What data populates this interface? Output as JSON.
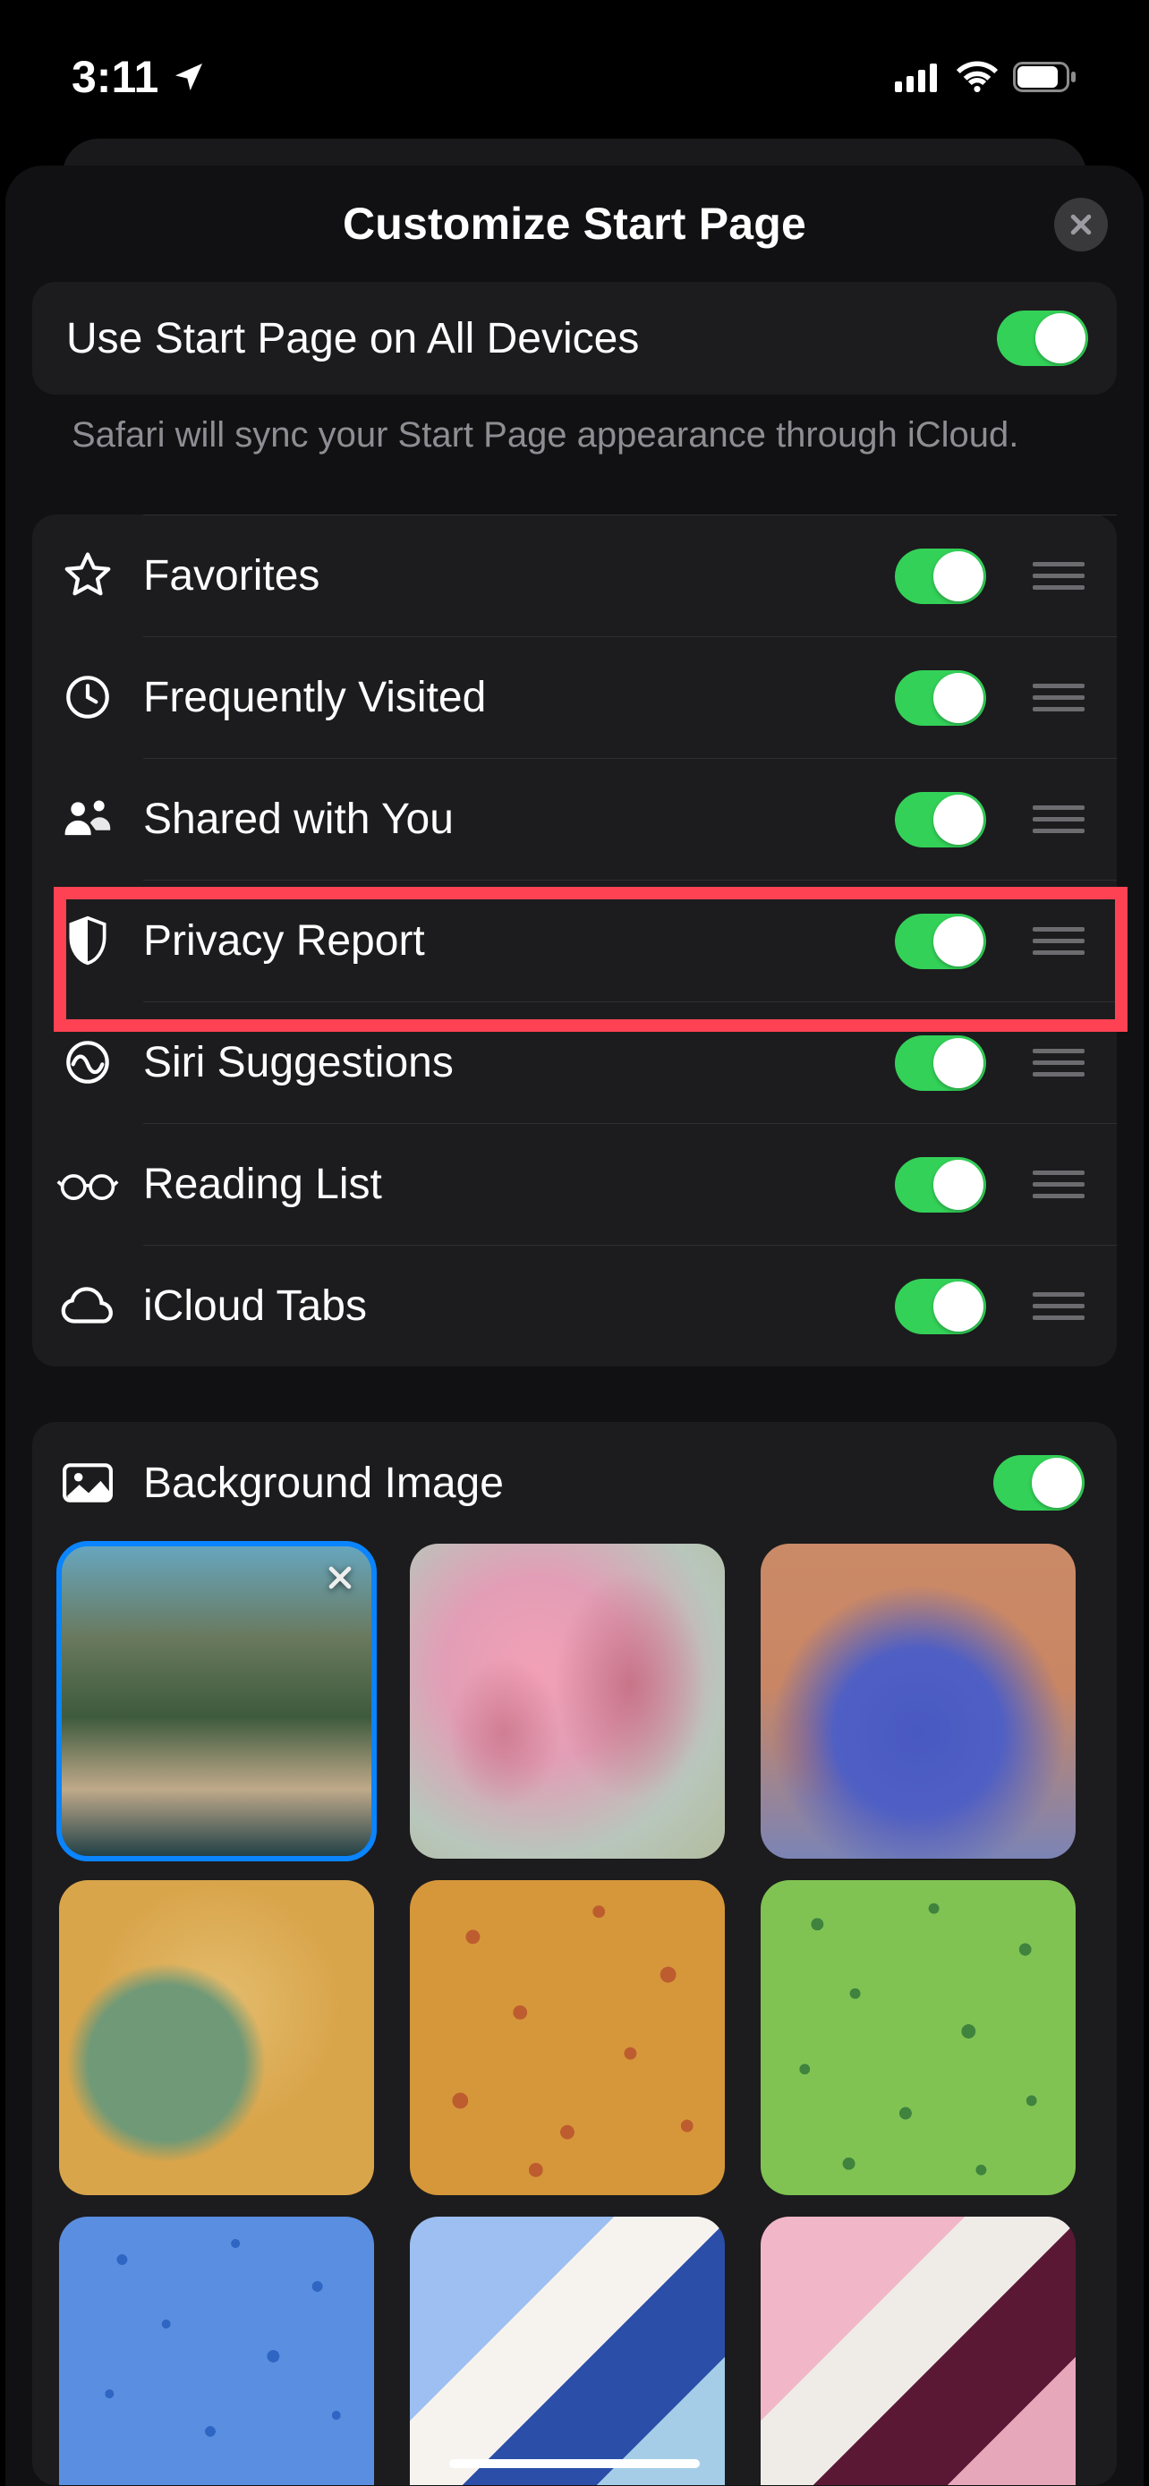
{
  "status": {
    "time": "3:11"
  },
  "sheet": {
    "title": "Customize Start Page"
  },
  "sync": {
    "label": "Use Start Page on All Devices",
    "description": "Safari will sync your Start Page appearance through iCloud."
  },
  "sections": [
    {
      "icon": "star",
      "label": "Favorites",
      "enabled": true
    },
    {
      "icon": "clock",
      "label": "Frequently Visited",
      "enabled": true
    },
    {
      "icon": "people",
      "label": "Shared with You",
      "enabled": true
    },
    {
      "icon": "shield",
      "label": "Privacy Report",
      "enabled": true
    },
    {
      "icon": "siri",
      "label": "Siri Suggestions",
      "enabled": true
    },
    {
      "icon": "glasses",
      "label": "Reading List",
      "enabled": true
    },
    {
      "icon": "cloud",
      "label": "iCloud Tabs",
      "enabled": true
    }
  ],
  "background": {
    "label": "Background Image",
    "enabled": true
  }
}
